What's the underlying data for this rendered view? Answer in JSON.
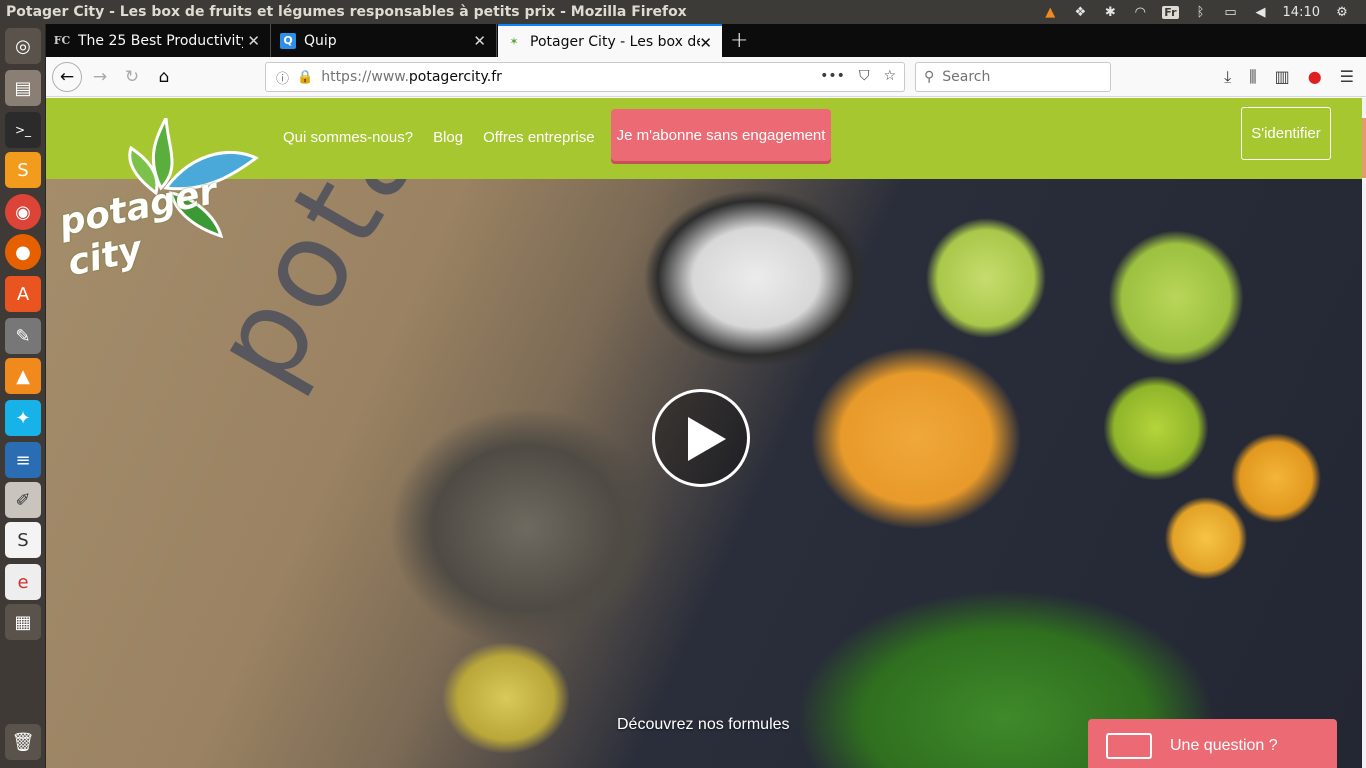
{
  "window_title": "Potager City - Les box de fruits et légumes responsables à petits prix - Mozilla Firefox",
  "tray": {
    "keyboard": "Fr",
    "time": "14:10"
  },
  "tabs": [
    {
      "favicon": "FC",
      "label": "The 25 Best Productivity",
      "active": false
    },
    {
      "favicon": "Q",
      "label": "Quip",
      "active": false
    },
    {
      "favicon": "✶",
      "label": "Potager City - Les box de",
      "active": true
    }
  ],
  "address_bar": {
    "url_prefix": "https://www.",
    "url_domain": "potagercity.fr"
  },
  "search": {
    "placeholder": "Search"
  },
  "site": {
    "logo_text": "potager city",
    "nav": [
      {
        "label": "Qui sommes-nous?"
      },
      {
        "label": "Blog"
      },
      {
        "label": "Offres entreprise"
      }
    ],
    "cta_label": "Je m'abonne sans engagement",
    "login_label": "S'identifier",
    "bag_text": "potager",
    "discover_label": "Découvrez nos formules",
    "question_label": "Une question ?"
  },
  "colors": {
    "header_green": "#a6c72f",
    "cta_pink": "#ec6a73",
    "firefox_blue": "#0a84ff"
  }
}
